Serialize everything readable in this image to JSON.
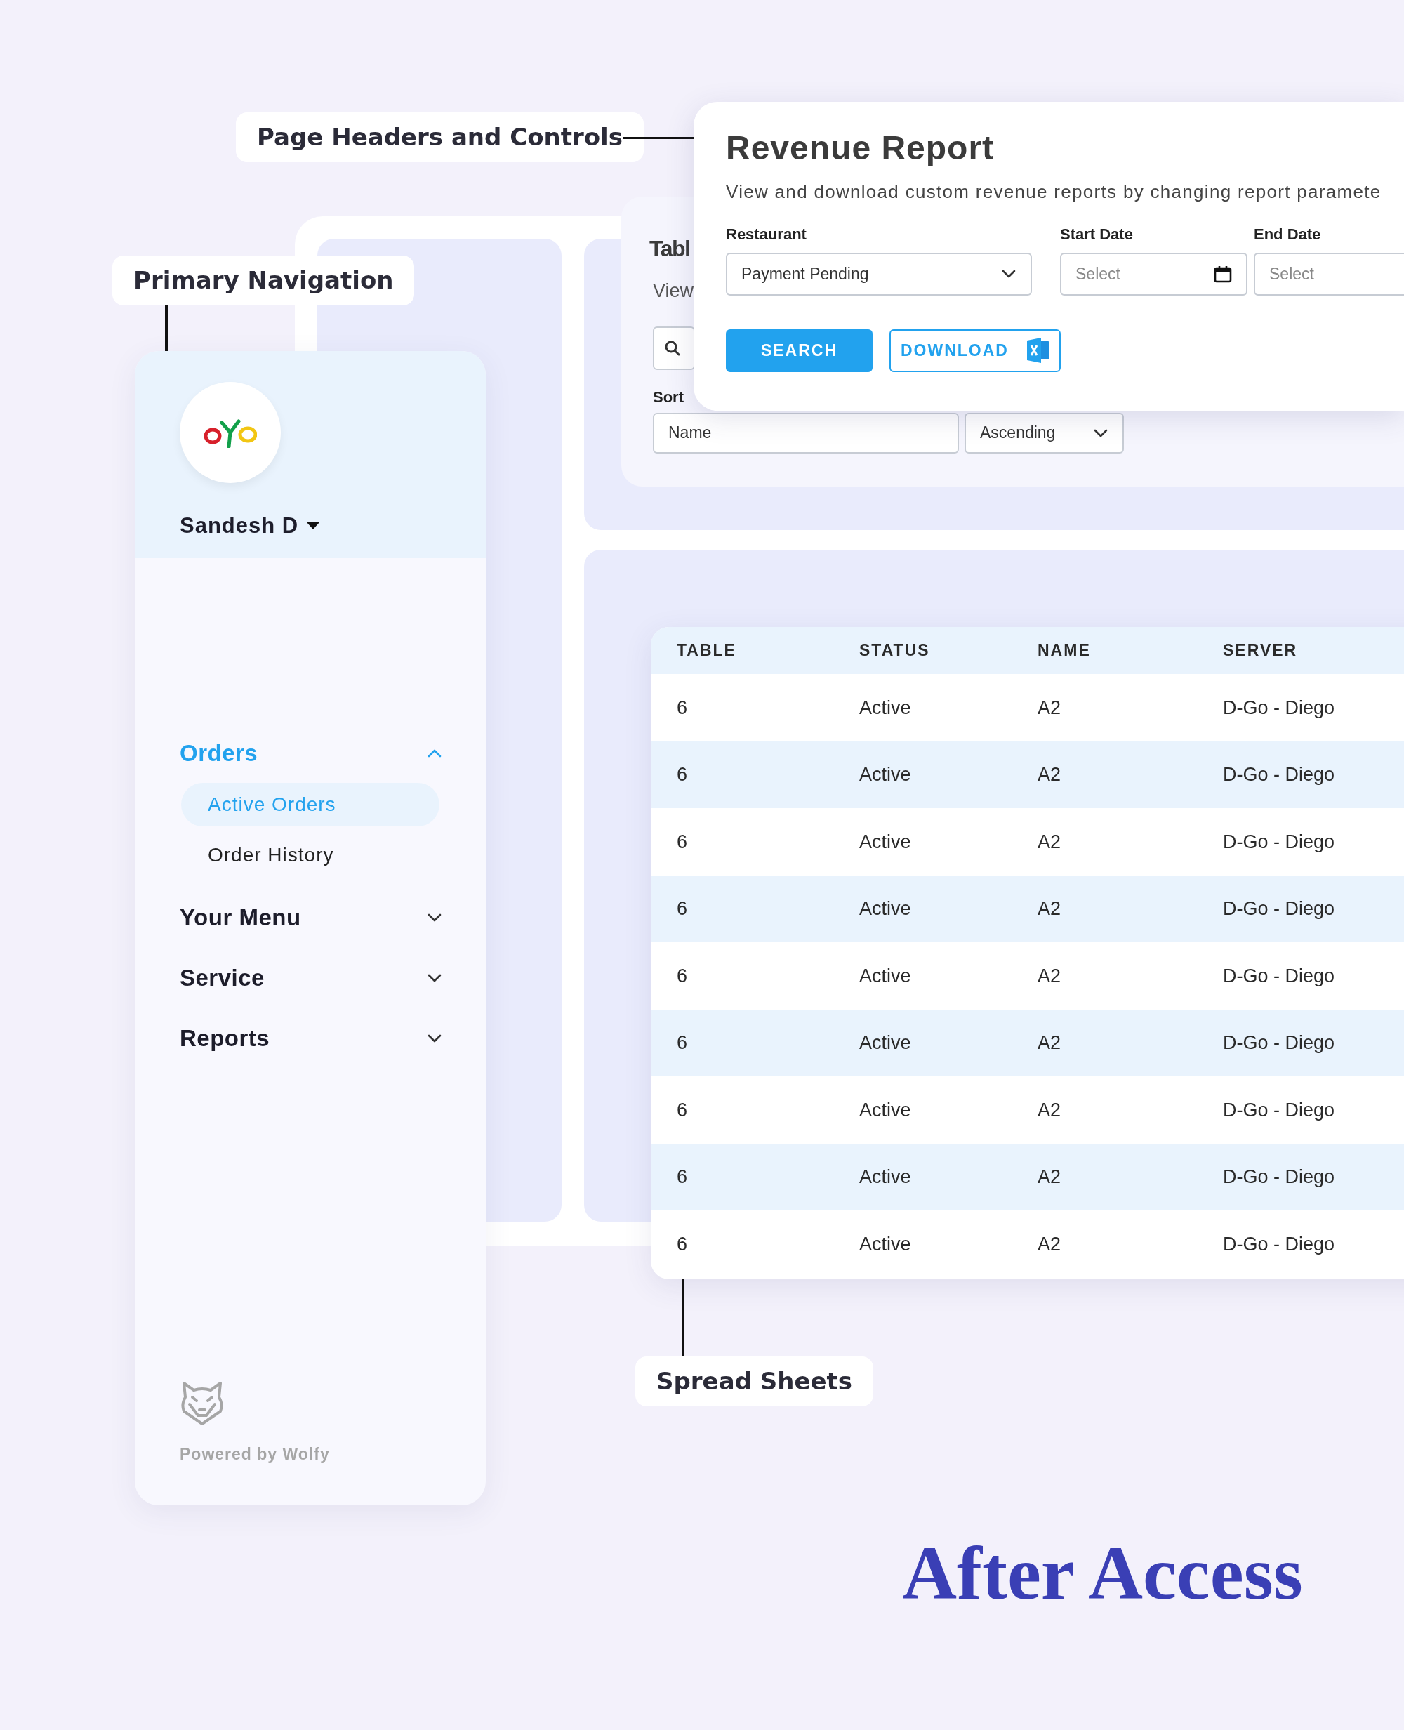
{
  "annotations": [
    {
      "label": "Page Headers and Controls"
    },
    {
      "label": "Primary Navigation"
    },
    {
      "label": "Spread Sheets"
    }
  ],
  "table_management": {
    "title": "Tabl",
    "subtitle": "View",
    "sort_label": "Sort",
    "sort_field": {
      "value": "Name"
    },
    "order_field": {
      "value": "Ascending"
    }
  },
  "revenue_report": {
    "title": "Revenue Report",
    "description": "View and download custom revenue reports by changing report paramete",
    "fields": [
      {
        "label": "Restaurant",
        "value": "Payment Pending",
        "kind": "select"
      },
      {
        "label": "Start Date",
        "placeholder": "Select",
        "kind": "date",
        "calendar_icon": true
      },
      {
        "label": "End Date",
        "placeholder": "Select",
        "kind": "date"
      }
    ],
    "buttons": [
      {
        "label": "SEARCH",
        "kind": "primary"
      },
      {
        "label": "DOWNLOAD",
        "kind": "download"
      }
    ]
  },
  "sidebar": {
    "user": "Sandesh D",
    "items": [
      {
        "label": "Orders",
        "selected": true,
        "expanded": true,
        "children": [
          {
            "label": "Active Orders",
            "selected": true
          },
          {
            "label": "Order History",
            "selected": false
          }
        ]
      },
      {
        "label": "Your Menu",
        "selected": false,
        "expanded": false
      },
      {
        "label": "Service",
        "selected": false,
        "expanded": false
      },
      {
        "label": "Reports",
        "selected": false,
        "expanded": false
      }
    ],
    "footer": "Powered by Wolfy"
  },
  "table": {
    "columns": [
      "TABLE",
      "STATUS",
      "NAME",
      "SERVER"
    ],
    "rows": [
      [
        "6",
        "Active",
        "A2",
        "D-Go - Diego"
      ],
      [
        "6",
        "Active",
        "A2",
        "D-Go - Diego"
      ],
      [
        "6",
        "Active",
        "A2",
        "D-Go - Diego"
      ],
      [
        "6",
        "Active",
        "A2",
        "D-Go - Diego"
      ],
      [
        "6",
        "Active",
        "A2",
        "D-Go - Diego"
      ],
      [
        "6",
        "Active",
        "A2",
        "D-Go - Diego"
      ],
      [
        "6",
        "Active",
        "A2",
        "D-Go - Diego"
      ],
      [
        "6",
        "Active",
        "A2",
        "D-Go - Diego"
      ],
      [
        "6",
        "Active",
        "A2",
        "D-Go - Diego"
      ]
    ]
  },
  "caption": "After Access"
}
